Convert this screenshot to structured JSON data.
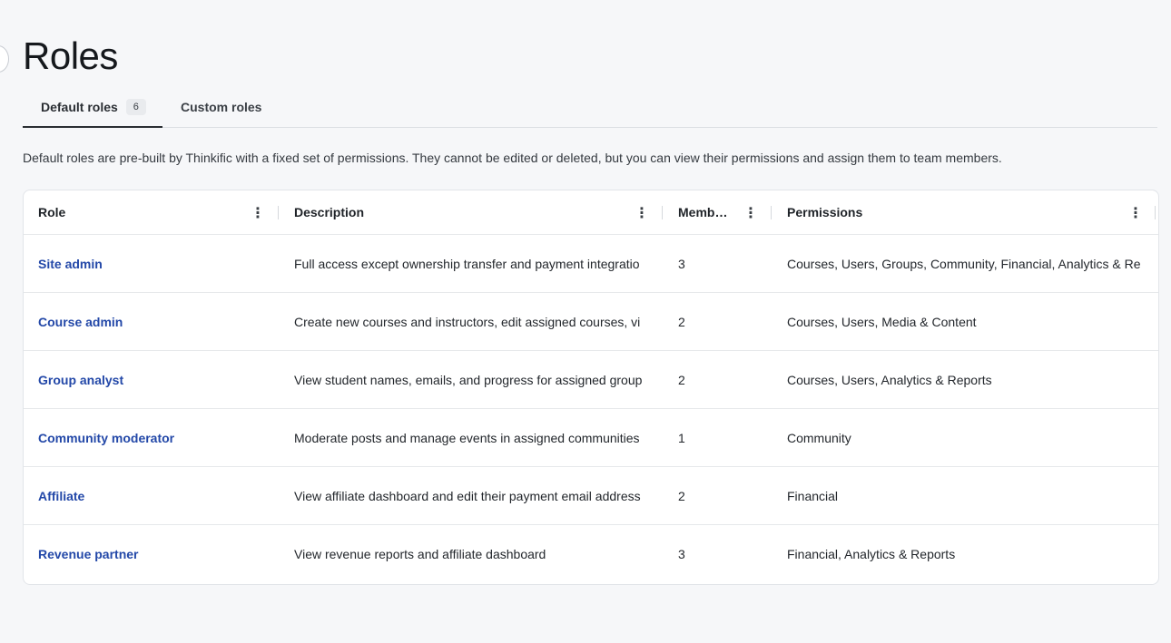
{
  "page": {
    "title": "Roles",
    "intro": "Default roles are pre-built by Thinkific with a fixed set of permissions. They cannot be edited or deleted, but you can view their permissions and assign them to team members."
  },
  "tabs": [
    {
      "label": "Default roles",
      "count": "6",
      "active": true
    },
    {
      "label": "Custom roles",
      "active": false
    }
  ],
  "table": {
    "columns": {
      "role": "Role",
      "description": "Description",
      "members": "Memb…",
      "permissions": "Permissions"
    },
    "rows": [
      {
        "role": "Site admin",
        "description": "Full access except ownership transfer and payment integratio",
        "members": "3",
        "permissions": "Courses, Users, Groups, Community, Financial, Analytics & Re"
      },
      {
        "role": "Course admin",
        "description": "Create new courses and instructors, edit assigned courses, vi",
        "members": "2",
        "permissions": "Courses, Users, Media & Content"
      },
      {
        "role": "Group analyst",
        "description": "View student names, emails, and progress for assigned group",
        "members": "2",
        "permissions": "Courses, Users, Analytics & Reports"
      },
      {
        "role": "Community moderator",
        "description": "Moderate posts and manage events in assigned communities",
        "members": "1",
        "permissions": "Community"
      },
      {
        "role": "Affiliate",
        "description": "View affiliate dashboard and edit their payment email address",
        "members": "2",
        "permissions": "Financial"
      },
      {
        "role": "Revenue partner",
        "description": "View revenue reports and affiliate dashboard",
        "members": "3",
        "permissions": "Financial, Analytics & Reports"
      }
    ]
  },
  "icons": {
    "column_menu": "⋮"
  }
}
